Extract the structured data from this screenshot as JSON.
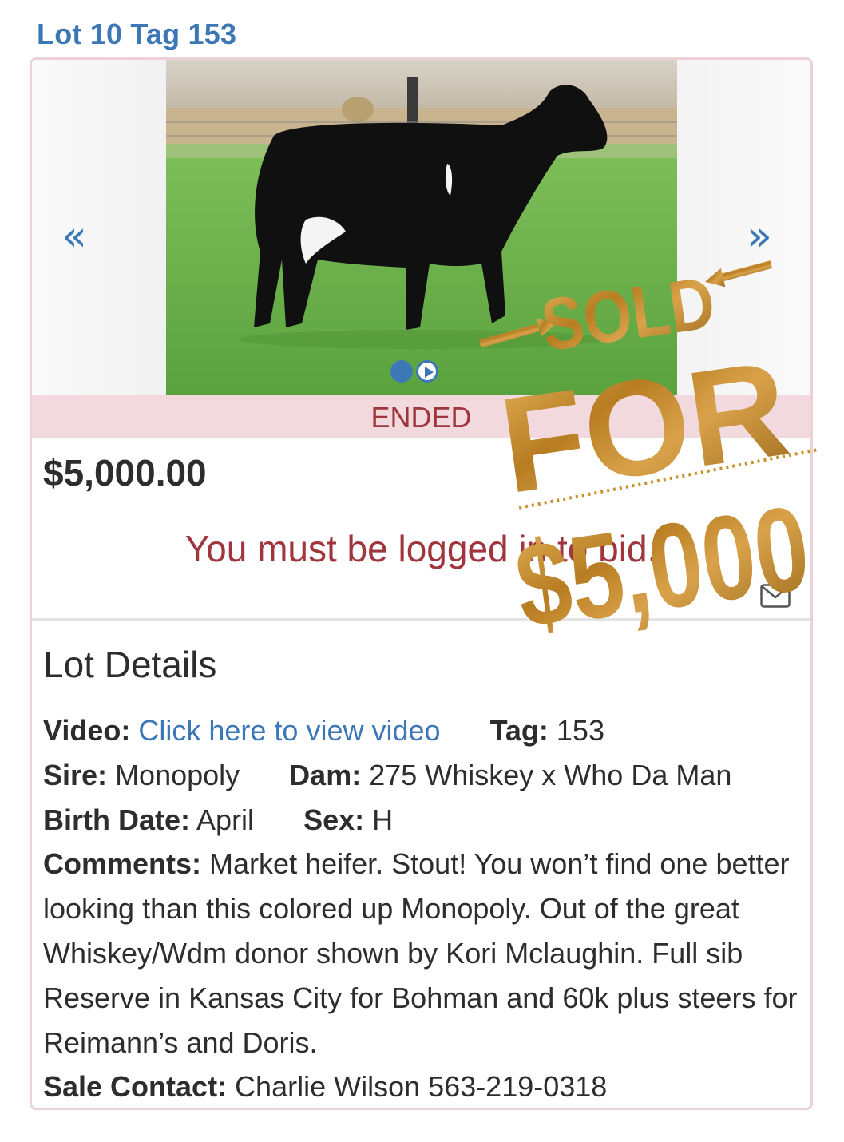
{
  "header": {
    "title": "Lot 10 Tag 153"
  },
  "carousel": {
    "prev_label": "«",
    "next_label": "»",
    "status": "ENDED"
  },
  "bid": {
    "price": "$5,000.00",
    "login_message": "You must be logged in to bid."
  },
  "details": {
    "heading": "Lot Details",
    "video_label": "Video:",
    "video_link": "Click here to view video",
    "tag_label": "Tag:",
    "tag_value": "153",
    "sire_label": "Sire:",
    "sire_value": "Monopoly",
    "dam_label": "Dam:",
    "dam_value": "275 Whiskey x Who Da Man",
    "birth_label": "Birth Date:",
    "birth_value": "April",
    "sex_label": "Sex:",
    "sex_value": "H",
    "comments_label": "Comments:",
    "comments_value": "Market heifer. Stout! You won’t find one better looking than this colored up Monopoly. Out of the great Whiskey/Wdm donor shown by Kori Mclaughin. Full sib Reserve in Kansas City for Bohman and 60k plus steers for Reimann’s and Doris.",
    "contact_label": "Sale Contact:",
    "contact_value": "Charlie Wilson 563-219-0318"
  },
  "overlay": {
    "line1": "SOLD",
    "line2": "FOR",
    "line3": "$5,000",
    "gold": "#c8912e"
  },
  "colors": {
    "accent": "#3d78b6",
    "ended_bg": "#f1d9dd",
    "ended_text": "#a0353d"
  }
}
